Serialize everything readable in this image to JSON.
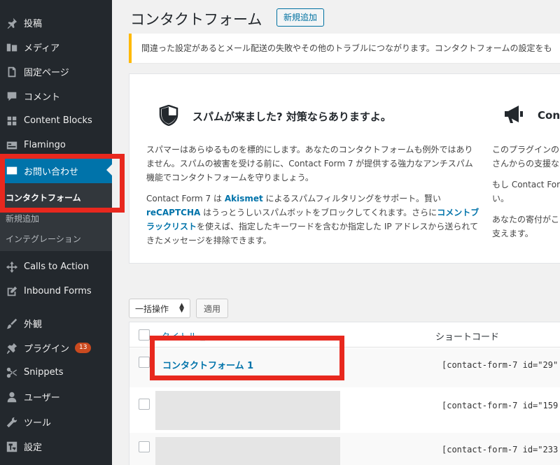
{
  "sidebar": {
    "items": [
      {
        "label": "投稿",
        "icon": "pin-icon"
      },
      {
        "label": "メディア",
        "icon": "media-icon"
      },
      {
        "label": "固定ページ",
        "icon": "page-icon"
      },
      {
        "label": "コメント",
        "icon": "comment-icon"
      },
      {
        "label": "Content Blocks",
        "icon": "grid-icon"
      },
      {
        "label": "Flamingo",
        "icon": "card-icon"
      },
      {
        "label": "お問い合わせ",
        "icon": "mail-icon"
      },
      {
        "label": "Calls to Action",
        "icon": "crosshair-icon"
      },
      {
        "label": "Inbound Forms",
        "icon": "edit-icon"
      },
      {
        "label": "外観",
        "icon": "brush-icon"
      },
      {
        "label": "プラグイン",
        "icon": "plugin-icon"
      },
      {
        "label": "Snippets",
        "icon": "scissors-icon"
      },
      {
        "label": "ユーザー",
        "icon": "user-icon"
      },
      {
        "label": "ツール",
        "icon": "wrench-icon"
      },
      {
        "label": "設定",
        "icon": "settings-icon"
      }
    ],
    "plugin_badge": "13",
    "submenu": [
      "コンタクトフォーム",
      "新規追加",
      "インテグレーション"
    ]
  },
  "header": {
    "title": "コンタクトフォーム",
    "add_new": "新規追加"
  },
  "notice": "間違った設定があるとメール配送の失敗やその他のトラブルにつながります。コンタクトフォームの設定をも",
  "welcome": {
    "left": {
      "heading": "スパムが来ました? 対策ならありますよ。",
      "p1": "スパマーはあらゆるものを標的にします。あなたのコンタクトフォームも例外ではありません。スパムの被害を受ける前に、Contact Form 7 が提供する強力なアンチスパム機能でコンタクトフォームを守りましょう。",
      "p2a": "Contact Form 7 は ",
      "p2_link1": "Akismet",
      "p2b": " によるスパムフィルタリングをサポート。賢い ",
      "p2_link2": "reCAPTCHA",
      "p2c": " はうっとうしいスパムボットをブロックしてくれます。さらに",
      "p2_link3": "コメントブラックリスト",
      "p2d": "を使えば、指定したキーワードを含むか指定した IP アドレスから送られてきたメッセージを排除できます。"
    },
    "right": {
      "heading": "Cont",
      "p1": "このプラグインの\nさんからの支援な",
      "p2": "もし Contact Form\nい。",
      "p3": "あなたの寄付がこ\n支えます。"
    }
  },
  "bulk": {
    "select_label": "一括操作",
    "apply_label": "適用"
  },
  "table": {
    "col_title": "タイトル",
    "col_shortcode": "ショートコード",
    "rows": [
      {
        "title": "コンタクトフォーム 1",
        "shortcode": "[contact-form-7 id=\"29\""
      },
      {
        "title": "",
        "shortcode": "[contact-form-7 id=\"159"
      },
      {
        "title": "",
        "shortcode": "[contact-form-7 id=\"233"
      }
    ]
  },
  "colors": {
    "sidebar_bg": "#23282d",
    "active_bg": "#0073aa",
    "link": "#0073aa",
    "highlight": "#e8281e",
    "notice_border": "#ffb900",
    "badge": "#ca4a1f"
  }
}
